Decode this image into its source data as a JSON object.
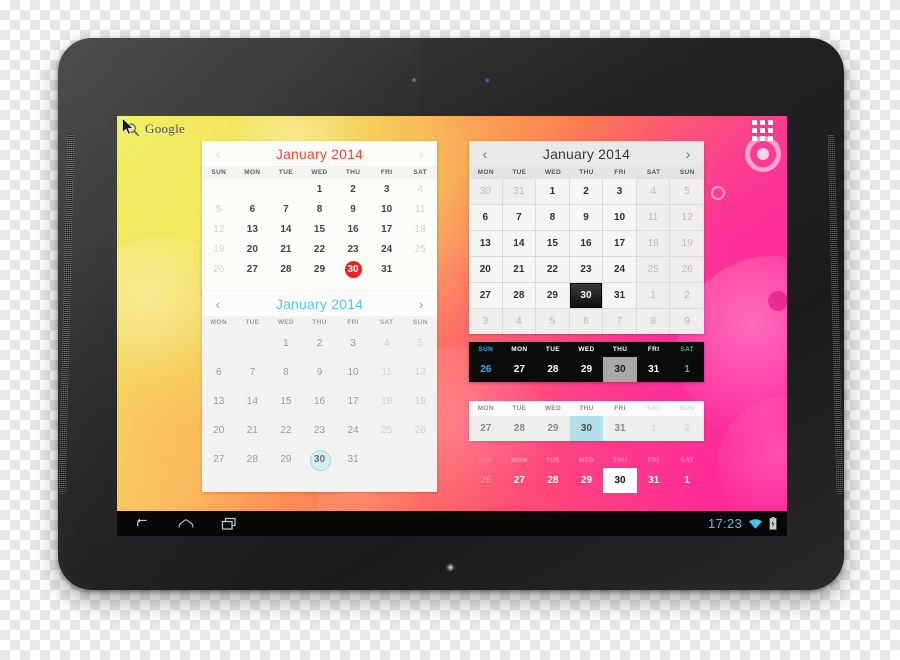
{
  "device": {
    "name": "android-tablet",
    "orientation": "landscape"
  },
  "home": {
    "search_widget": {
      "label": "Google",
      "icon": "search-icon"
    },
    "app_drawer": {
      "icon": "apps-grid-icon"
    },
    "cursor": {
      "icon": "mouse-pointer-icon"
    }
  },
  "status_bar": {
    "clock": "17:23",
    "wifi_icon": "wifi-icon",
    "battery_icon": "battery-icon"
  },
  "nav_bar": {
    "back_label": "Back",
    "home_label": "Home",
    "recents_label": "Recent apps"
  },
  "widgets": [
    {
      "id": "calendar-red",
      "title": "January 2014",
      "accent": "#ff4530",
      "prev_arrow": "‹",
      "next_arrow": "›",
      "week_start": "SUN",
      "dow": [
        "SUN",
        "MON",
        "TUE",
        "WED",
        "THU",
        "FRI",
        "SAT"
      ],
      "selected_day": "30",
      "weeks": [
        [
          "",
          "",
          "",
          "1",
          "2",
          "3",
          "4"
        ],
        [
          "5",
          "6",
          "7",
          "8",
          "9",
          "10",
          "11"
        ],
        [
          "12",
          "13",
          "14",
          "15",
          "16",
          "17",
          "18"
        ],
        [
          "19",
          "20",
          "21",
          "22",
          "23",
          "24",
          "25"
        ],
        [
          "26",
          "27",
          "28",
          "29",
          "30",
          "31",
          ""
        ]
      ],
      "muted_cells": [
        [
          0,
          6
        ],
        [
          1,
          0
        ],
        [
          1,
          6
        ],
        [
          2,
          0
        ],
        [
          2,
          6
        ],
        [
          3,
          0
        ],
        [
          3,
          6
        ],
        [
          4,
          0
        ]
      ]
    },
    {
      "id": "calendar-blue",
      "title": "January 2014",
      "accent": "#55c6ef",
      "prev_arrow": "‹",
      "next_arrow": "›",
      "week_start": "MON",
      "dow": [
        "MON",
        "TUE",
        "WED",
        "THU",
        "FRI",
        "SAT",
        "SUN"
      ],
      "selected_day": "30",
      "weeks": [
        [
          "",
          "",
          "1",
          "2",
          "3",
          "4",
          "5"
        ],
        [
          "6",
          "7",
          "8",
          "9",
          "10",
          "11",
          "12"
        ],
        [
          "13",
          "14",
          "15",
          "16",
          "17",
          "18",
          "19"
        ],
        [
          "20",
          "21",
          "22",
          "23",
          "24",
          "25",
          "26"
        ],
        [
          "27",
          "28",
          "29",
          "30",
          "31",
          "",
          ""
        ]
      ],
      "muted_cells": [
        [
          0,
          5
        ],
        [
          0,
          6
        ],
        [
          1,
          5
        ],
        [
          1,
          6
        ],
        [
          2,
          5
        ],
        [
          2,
          6
        ],
        [
          3,
          5
        ],
        [
          3,
          6
        ]
      ]
    },
    {
      "id": "calendar-grid",
      "title": "January 2014",
      "accent": "#3b3b3b",
      "prev_arrow": "‹",
      "next_arrow": "›",
      "week_start": "MON",
      "dow": [
        "MON",
        "TUE",
        "WED",
        "THU",
        "FRI",
        "SAT",
        "SUN"
      ],
      "selected_day": "30",
      "weeks": [
        [
          "30",
          "31",
          "1",
          "2",
          "3",
          "4",
          "5"
        ],
        [
          "6",
          "7",
          "8",
          "9",
          "10",
          "11",
          "12"
        ],
        [
          "13",
          "14",
          "15",
          "16",
          "17",
          "18",
          "19"
        ],
        [
          "20",
          "21",
          "22",
          "23",
          "24",
          "25",
          "26"
        ],
        [
          "27",
          "28",
          "29",
          "30",
          "31",
          "1",
          "2"
        ],
        [
          "3",
          "4",
          "5",
          "6",
          "7",
          "8",
          "9"
        ]
      ],
      "muted_cells": [
        [
          0,
          0
        ],
        [
          0,
          1
        ],
        [
          0,
          5
        ],
        [
          0,
          6
        ],
        [
          1,
          5
        ],
        [
          1,
          6
        ],
        [
          2,
          5
        ],
        [
          2,
          6
        ],
        [
          3,
          5
        ],
        [
          3,
          6
        ],
        [
          4,
          5
        ],
        [
          4,
          6
        ],
        [
          5,
          0
        ],
        [
          5,
          1
        ],
        [
          5,
          2
        ],
        [
          5,
          3
        ],
        [
          5,
          4
        ],
        [
          5,
          5
        ],
        [
          5,
          6
        ]
      ]
    },
    {
      "id": "week-strip-dark",
      "theme": "dark",
      "dow": [
        "SUN",
        "MON",
        "TUE",
        "WED",
        "THU",
        "FRI",
        "SAT"
      ],
      "days": [
        "26",
        "27",
        "28",
        "29",
        "30",
        "31",
        "1"
      ],
      "selected_day": "30",
      "sunday_color": "#2bb3e8",
      "saturday_color": "#35c46a"
    },
    {
      "id": "week-strip-light",
      "theme": "light",
      "dow": [
        "MON",
        "TUE",
        "WED",
        "THU",
        "FRI",
        "SAT",
        "SUN"
      ],
      "days": [
        "27",
        "28",
        "29",
        "30",
        "31",
        "1",
        "2"
      ],
      "selected_day": "30",
      "weekend_color": "#bfe7e0"
    },
    {
      "id": "week-strip-transparent",
      "theme": "transparent",
      "dow": [
        "SUN",
        "MON",
        "TUE",
        "WED",
        "THU",
        "FRI",
        "SAT"
      ],
      "days": [
        "26",
        "27",
        "28",
        "29",
        "30",
        "31",
        "1"
      ],
      "selected_day": "30"
    }
  ]
}
